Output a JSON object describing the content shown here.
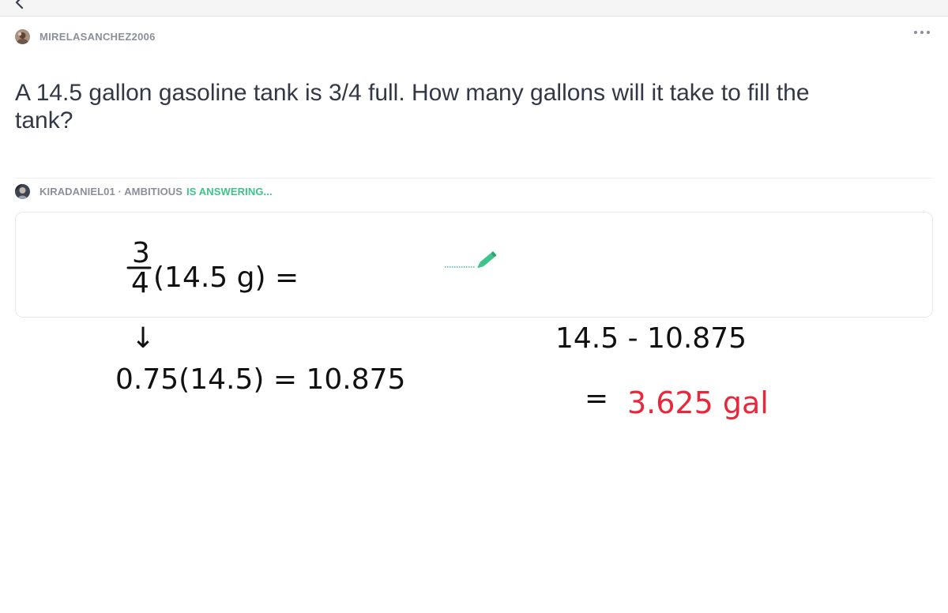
{
  "asker": {
    "username": "MIRELASANCHEZ2006",
    "avatar_icon": "user-avatar-icon"
  },
  "question": {
    "text": "A 14.5 gallon gasoline tank is 3/4 full. How many gallons will it take to fill the tank?"
  },
  "answerer": {
    "name_rank": "KIRADANIEL01 · AMBITIOUS",
    "status": "IS ANSWERING...",
    "status_color": "#3cc48a"
  },
  "handwriting": {
    "fraction_numerator": "3",
    "fraction_denominator": "4",
    "step1": "(14.5 g) =",
    "arrow": "↓",
    "step2": "0.75(14.5) = 10.875",
    "step3": "14.5 - 10.875",
    "equals": "=",
    "result": "3.625 gal",
    "result_color": "#e8283a"
  },
  "icons": {
    "back": "chevron-left-icon",
    "more": "more-options-icon",
    "pencil": "pencil-icon",
    "pencil_color": "#3cc48a"
  }
}
